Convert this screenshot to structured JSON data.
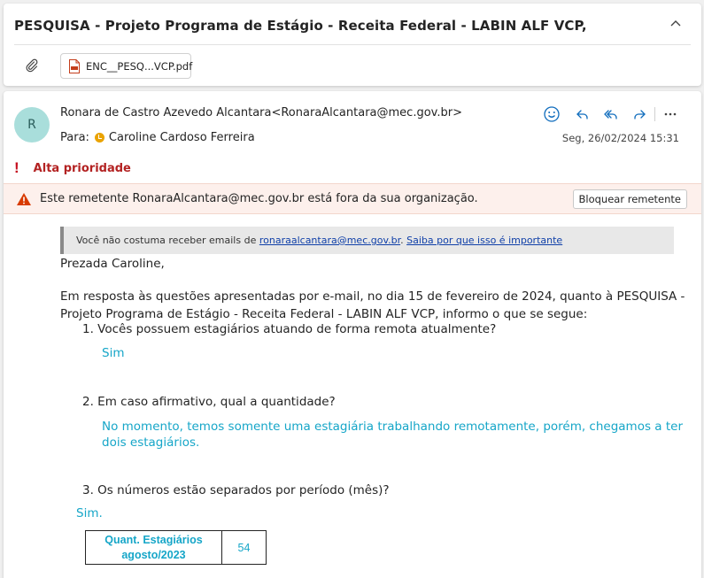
{
  "email": {
    "subject": "PESQUISA - Projeto Programa de Estágio - Receita Federal - LABIN ALF VCP,",
    "attachment_name": "ENC__PESQ...VCP.pdf",
    "avatar_initial": "R",
    "sender": "Ronara de Castro Azevedo Alcantara<RonaraAlcantara@mec.gov.br>",
    "to_label": "Para:",
    "recipient": "Caroline Cardoso Ferreira",
    "date": "Seg, 26/02/2024 15:31",
    "priority_label": "Alta prioridade",
    "external_warning": "Este remetente RonaraAlcantara@mec.gov.br está fora da sua organização.",
    "block_button": "Bloquear remetente",
    "notice_prefix": "Você não costuma receber emails de",
    "notice_email": "ronaraalcantara@mec.gov.br",
    "notice_sep": ".",
    "notice_link": "Saiba por que isso é importante"
  },
  "body": {
    "greeting": "Prezada Caroline,",
    "intro_line1": "Em resposta às questões apresentadas por e-mail, no dia 15 de fevereiro de 2024, quanto à PESQUISA -",
    "intro_line2": "Projeto Programa de Estágio - Receita Federal - LABIN ALF VCP, informo o que se segue:",
    "q1": "1. Vocês possuem estagiários atuando de forma remota atualmente?",
    "a1": "Sim",
    "q2": "2. Em caso afirmativo, qual a quantidade?",
    "a2_line1": "No momento, temos somente uma estagiária trabalhando remotamente, porém, chegamos a ter",
    "a2_line2": "dois estagiários.",
    "q3": "3. Os números estão separados por período (mês)?",
    "a3": "Sim.",
    "table": {
      "header_line1": "Quant. Estagiários",
      "header_line2": "agosto/2023",
      "value": "54"
    }
  },
  "icons": {
    "collapse": "chevron-up-icon",
    "attach": "paperclip-icon",
    "file": "pdf-file-icon",
    "emoji": "smiley-icon",
    "reply": "reply-icon",
    "reply_all": "reply-all-icon",
    "forward": "forward-icon",
    "more": "more-icon",
    "priority": "exclamation-icon",
    "warning": "warning-icon"
  },
  "colors": {
    "accent": "#0f6cbd",
    "answer": "#16a6c8",
    "priority": "#c50f1f",
    "avatar_bg": "#a9dedb"
  }
}
